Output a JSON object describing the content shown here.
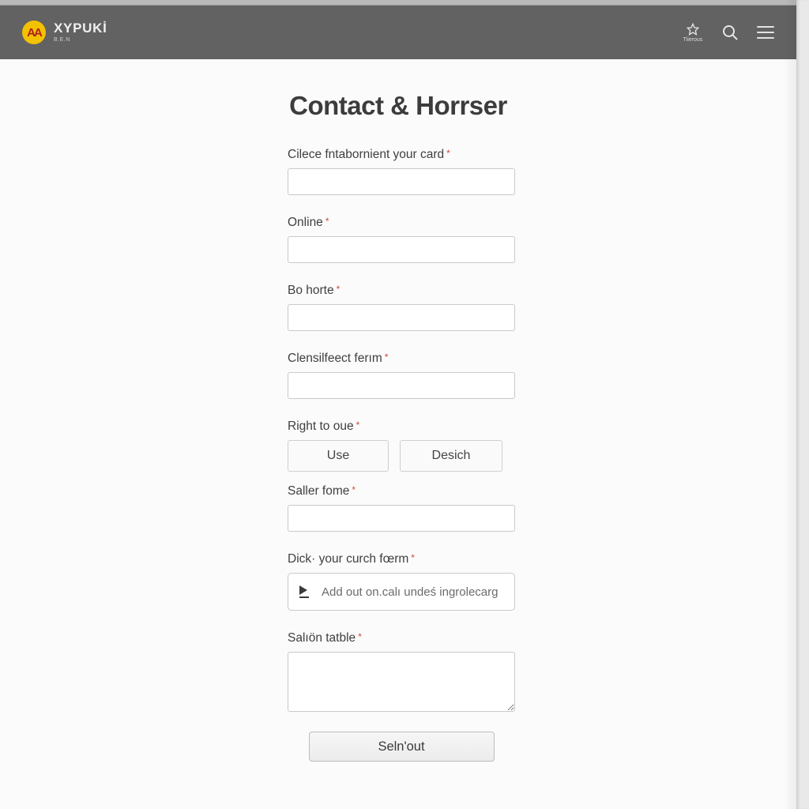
{
  "header": {
    "logo_text": "AA",
    "brand_name": "XYPUKİ",
    "brand_sub": "B.E.N",
    "star_label": "Tiierous"
  },
  "page": {
    "title": "Contact & Horrser"
  },
  "form": {
    "fields": {
      "card": {
        "label": "Cilece fntabornient your card",
        "value": ""
      },
      "online": {
        "label": "Online",
        "value": ""
      },
      "bohorte": {
        "label": "Bo horte",
        "value": ""
      },
      "clens": {
        "label": "Clensilfeect ferım",
        "value": ""
      },
      "right": {
        "label": "Right to oue",
        "option_a": "Use",
        "option_b": "Desich"
      },
      "saller": {
        "label": "Saller fome",
        "value": ""
      },
      "upload": {
        "label": "Dick· your curch fœrm",
        "placeholder": "Add out on.calı undeś ingrolecarg"
      },
      "textarea": {
        "label": "Salıön tatble",
        "value": ""
      }
    },
    "submit_label": "Seln'out"
  }
}
